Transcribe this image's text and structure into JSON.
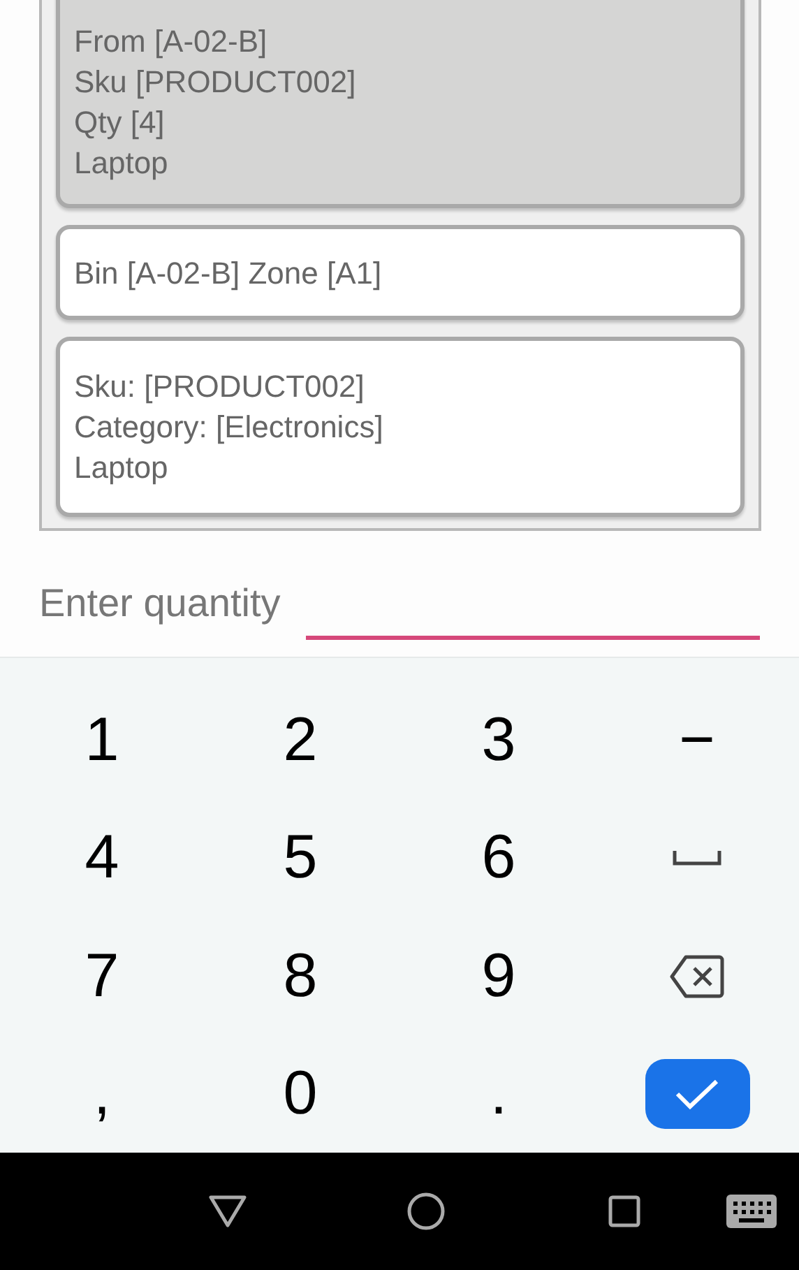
{
  "cards": [
    {
      "selected": true,
      "lines": [
        "From [A-02-B]",
        "Sku [PRODUCT002]",
        "Qty [4]",
        "Laptop"
      ]
    },
    {
      "selected": false,
      "lines": [
        "Bin [A-02-B] Zone [A1]"
      ]
    },
    {
      "selected": false,
      "lines": [
        "Sku: [PRODUCT002]",
        "Category: [Electronics]",
        "Laptop"
      ]
    }
  ],
  "quantity_field": {
    "placeholder": "Enter quantity"
  },
  "keyboard": {
    "keys": [
      {
        "kind": "char",
        "label": "1"
      },
      {
        "kind": "char",
        "label": "2"
      },
      {
        "kind": "char",
        "label": "3"
      },
      {
        "kind": "char",
        "label": "−"
      },
      {
        "kind": "char",
        "label": "4"
      },
      {
        "kind": "char",
        "label": "5"
      },
      {
        "kind": "char",
        "label": "6"
      },
      {
        "kind": "space"
      },
      {
        "kind": "char",
        "label": "7"
      },
      {
        "kind": "char",
        "label": "8"
      },
      {
        "kind": "char",
        "label": "9"
      },
      {
        "kind": "backspace"
      },
      {
        "kind": "char",
        "label": ","
      },
      {
        "kind": "char",
        "label": "0"
      },
      {
        "kind": "char",
        "label": "."
      },
      {
        "kind": "done"
      }
    ]
  }
}
